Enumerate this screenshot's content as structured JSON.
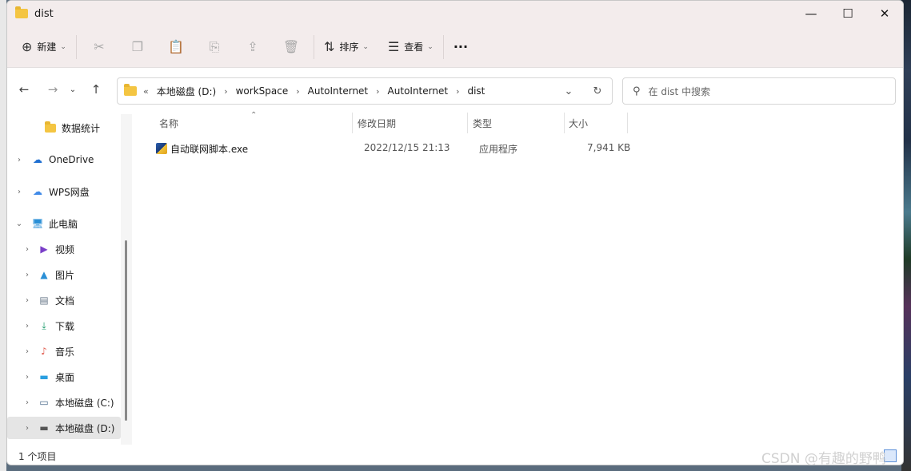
{
  "window": {
    "title": "dist"
  },
  "window_controls": {
    "minimize": "—",
    "maximize": "☐",
    "close": "✕"
  },
  "toolbar": {
    "new_label": "新建",
    "sort_label": "排序",
    "view_label": "查看",
    "more_label": "···"
  },
  "address": {
    "overflow": "«",
    "crumbs": [
      "本地磁盘 (D:)",
      "workSpace",
      "AutoInternet",
      "AutoInternet",
      "dist"
    ]
  },
  "search": {
    "placeholder": "在 dist 中搜索"
  },
  "sidebar": {
    "items": [
      {
        "label": "数据统计"
      },
      {
        "label": "OneDrive"
      },
      {
        "label": "WPS网盘"
      },
      {
        "label": "此电脑"
      },
      {
        "label": "视频"
      },
      {
        "label": "图片"
      },
      {
        "label": "文档"
      },
      {
        "label": "下载"
      },
      {
        "label": "音乐"
      },
      {
        "label": "桌面"
      },
      {
        "label": "本地磁盘 (C:)"
      },
      {
        "label": "本地磁盘 (D:)"
      }
    ]
  },
  "columns": {
    "name": "名称",
    "modified": "修改日期",
    "type": "类型",
    "size": "大小"
  },
  "files": [
    {
      "name": "自动联网脚本.exe",
      "modified": "2022/12/15 21:13",
      "type": "应用程序",
      "size": "7,941 KB"
    }
  ],
  "status": {
    "count": "1 个项目"
  },
  "watermark": "CSDN @有趣的野鸭",
  "colors": {
    "titlebar": "#f3ecec",
    "selected": "#e5e5e5",
    "folder": "#f4c542"
  }
}
